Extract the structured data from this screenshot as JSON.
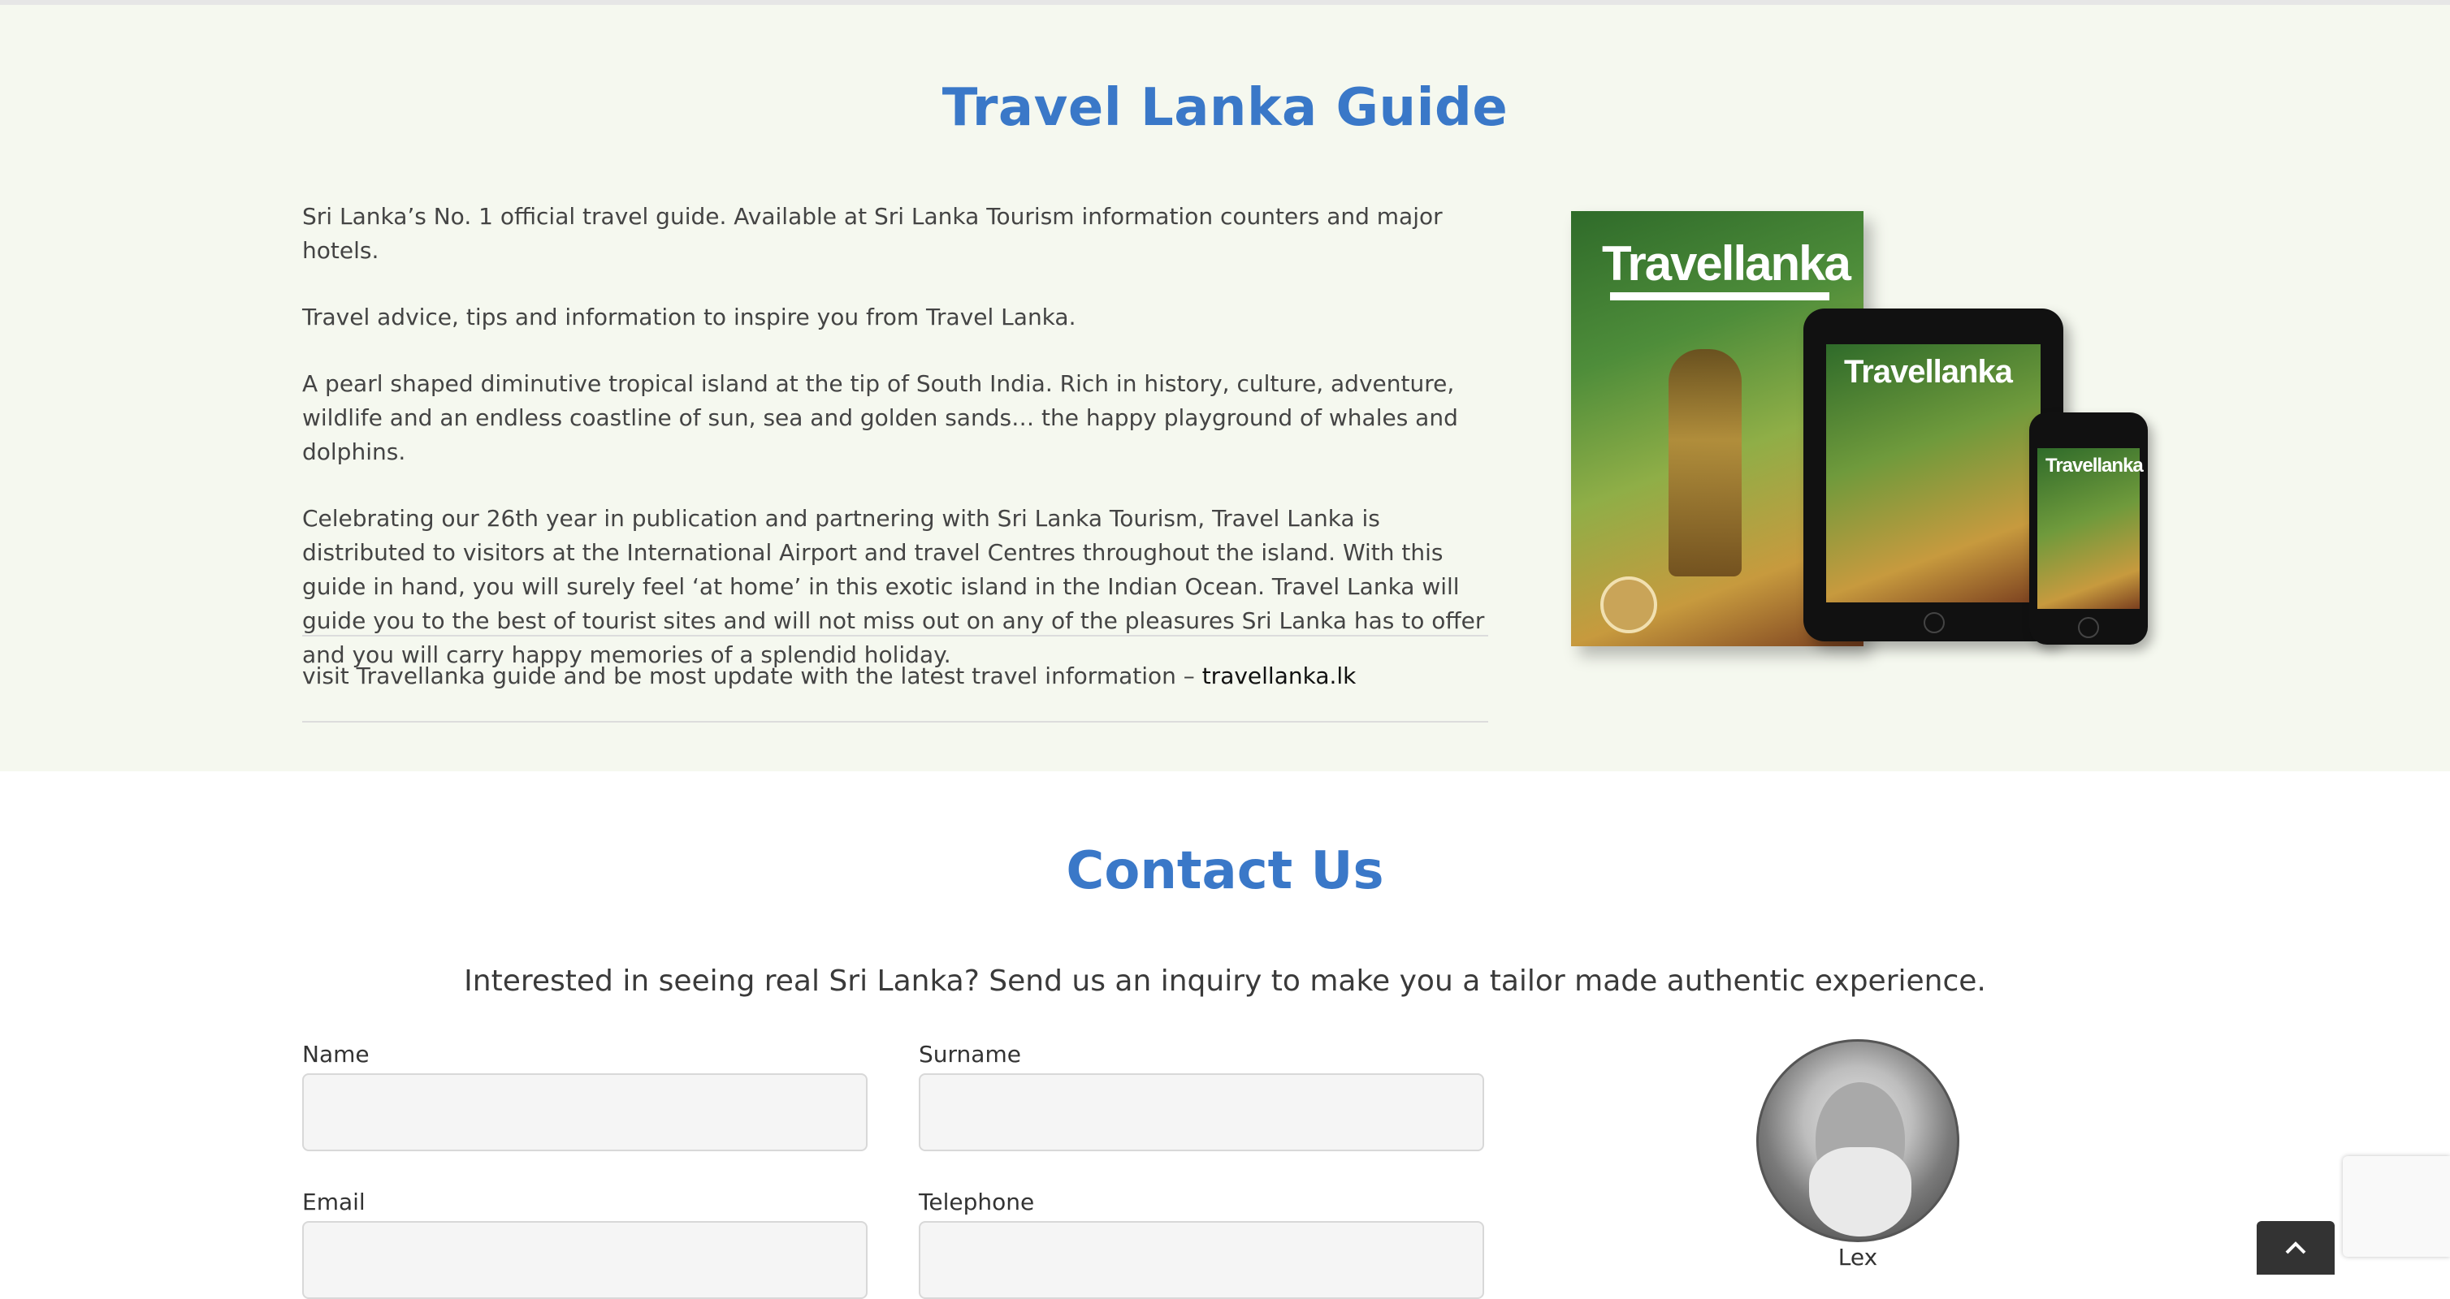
{
  "guide": {
    "title": "Travel Lanka Guide",
    "paragraphs": [
      "Sri Lanka’s No. 1 official travel guide. Available at Sri Lanka Tourism information counters and major hotels.",
      "Travel advice, tips and information to inspire you from Travel Lanka.",
      "A pearl shaped diminutive tropical island at the tip of South India. Rich in history, culture, adventure, wildlife and an endless coastline of sun, sea and golden sands… the happy playground of whales and dolphins.",
      "Celebrating our 26th year in publication and partnering with Sri Lanka Tourism, Travel Lanka is distributed to visitors at the International Airport and travel Centres throughout the island. With this guide in hand, you will surely feel ‘at home’ in this exotic island in the Indian Ocean. Travel Lanka will guide you to the best of tourist sites and will not miss out on any of the pleasures Sri Lanka has to offer and you will carry happy memories of a splendid holiday."
    ],
    "visit_text": "visit Travellanka guide and be most update with the latest travel information – ",
    "visit_link": "travellanka.lk",
    "mockup": {
      "logo": "Travellanka"
    }
  },
  "contact": {
    "title": "Contact Us",
    "subtitle": "Interested in seeing real Sri Lanka? Send us an inquiry to make you a tailor made authentic experience.",
    "fields": {
      "name_label": "Name",
      "surname_label": "Surname",
      "email_label": "Email",
      "telephone_label": "Telephone"
    },
    "agent": {
      "name": "Lex"
    }
  },
  "colors": {
    "heading": "#3a78c8",
    "guide_background": "#f5f8ef",
    "input_background": "#f5f5f5"
  },
  "icons": {
    "back_to_top": "chevron-up-icon"
  }
}
